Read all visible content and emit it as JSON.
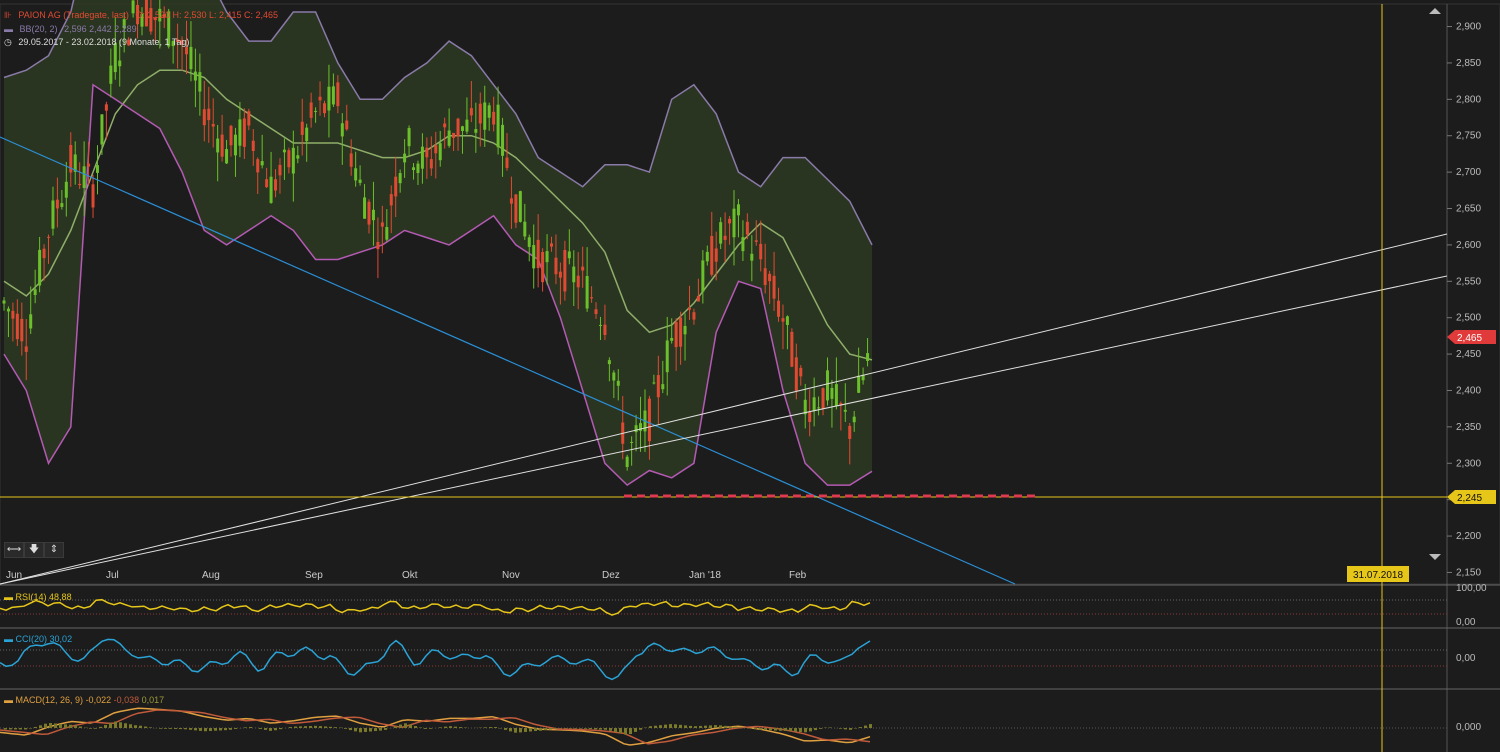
{
  "header": {
    "instrument": "PAION AG (Tradegate, last)",
    "ohlc": "O: 2,520  H: 2,530  L: 2,415  C: 2,465",
    "bb_label": "BB(20, 2)",
    "bb_values": "2,596  2,442  2,289",
    "period": "29.05.2017 - 23.02.2018  (9 Monate, 1 Tag)"
  },
  "price_axis": {
    "ticks": [
      "2,900",
      "2,850",
      "2,800",
      "2,750",
      "2,700",
      "2,650",
      "2,600",
      "2,550",
      "2,500",
      "2,450",
      "2,400",
      "2,350",
      "2,300",
      "2,250",
      "2,200",
      "2,150"
    ],
    "last_price": "2,465",
    "hline_price": "2,245"
  },
  "time_axis": {
    "labels": [
      "Jun",
      "Jul",
      "Aug",
      "Sep",
      "Okt",
      "Nov",
      "Dez",
      "Jan '18",
      "Feb"
    ],
    "marker_date": "31.07.2018"
  },
  "indicators": {
    "rsi": {
      "label": "RSI(14)",
      "value": "48,88",
      "ticks": [
        "100,00",
        "0,00"
      ]
    },
    "cci": {
      "label": "CCI(20)",
      "value": "30,02",
      "ticks": [
        "0,00"
      ]
    },
    "macd": {
      "label": "MACD(12, 26, 9)",
      "v1": "-0,022",
      "v2": "-0,038",
      "v3": "0,017",
      "ticks": [
        "0,000"
      ]
    }
  },
  "colors": {
    "up": "#6abf2a",
    "down": "#e04a32",
    "band": "#8a7aa8",
    "mid": "#8fae6a",
    "lower": "#b45ab4",
    "yellow": "#e6c619",
    "rsi": "#e6c619",
    "cci": "#2aa3d6",
    "macd": "#e0a040",
    "signal": "#c05a3a",
    "trend": "#2a8fd6",
    "support": "#e0e0e0"
  },
  "chart_data": {
    "type": "candlestick",
    "title": "PAION AG (Tradegate, last)",
    "ylim": [
      2.13,
      2.92
    ],
    "weekly_close": [
      2.52,
      2.48,
      2.62,
      2.71,
      2.68,
      2.86,
      2.93,
      2.91,
      2.88,
      2.79,
      2.73,
      2.76,
      2.68,
      2.72,
      2.78,
      2.8,
      2.68,
      2.61,
      2.74,
      2.71,
      2.76,
      2.76,
      2.79,
      2.66,
      2.58,
      2.57,
      2.55,
      2.5,
      2.31,
      2.36,
      2.47,
      2.52,
      2.6,
      2.63,
      2.58,
      2.5,
      2.38,
      2.4,
      2.35,
      2.465
    ],
    "bb_upper": [
      2.83,
      2.84,
      2.86,
      2.92,
      3.05,
      3.1,
      3.1,
      3.08,
      3.02,
      2.98,
      2.92,
      2.88,
      2.88,
      2.92,
      2.92,
      2.85,
      2.8,
      2.8,
      2.83,
      2.85,
      2.88,
      2.86,
      2.82,
      2.78,
      2.72,
      2.7,
      2.68,
      2.71,
      2.71,
      2.7,
      2.8,
      2.82,
      2.78,
      2.7,
      2.68,
      2.72,
      2.72,
      2.69,
      2.66,
      2.6
    ],
    "bb_mid": [
      2.55,
      2.53,
      2.56,
      2.62,
      2.7,
      2.78,
      2.82,
      2.84,
      2.84,
      2.83,
      2.8,
      2.78,
      2.76,
      2.74,
      2.74,
      2.74,
      2.73,
      2.72,
      2.72,
      2.73,
      2.75,
      2.75,
      2.74,
      2.72,
      2.69,
      2.66,
      2.63,
      2.59,
      2.51,
      2.48,
      2.49,
      2.52,
      2.56,
      2.6,
      2.63,
      2.61,
      2.55,
      2.49,
      2.45,
      2.442
    ],
    "bb_lower": [
      2.45,
      2.4,
      2.3,
      2.35,
      2.82,
      2.8,
      2.78,
      2.76,
      2.7,
      2.62,
      2.6,
      2.62,
      2.64,
      2.62,
      2.58,
      2.58,
      2.59,
      2.6,
      2.62,
      2.61,
      2.6,
      2.62,
      2.64,
      2.6,
      2.58,
      2.5,
      2.4,
      2.3,
      2.27,
      2.29,
      2.28,
      2.3,
      2.48,
      2.55,
      2.54,
      2.4,
      2.3,
      2.27,
      2.27,
      2.289
    ]
  }
}
